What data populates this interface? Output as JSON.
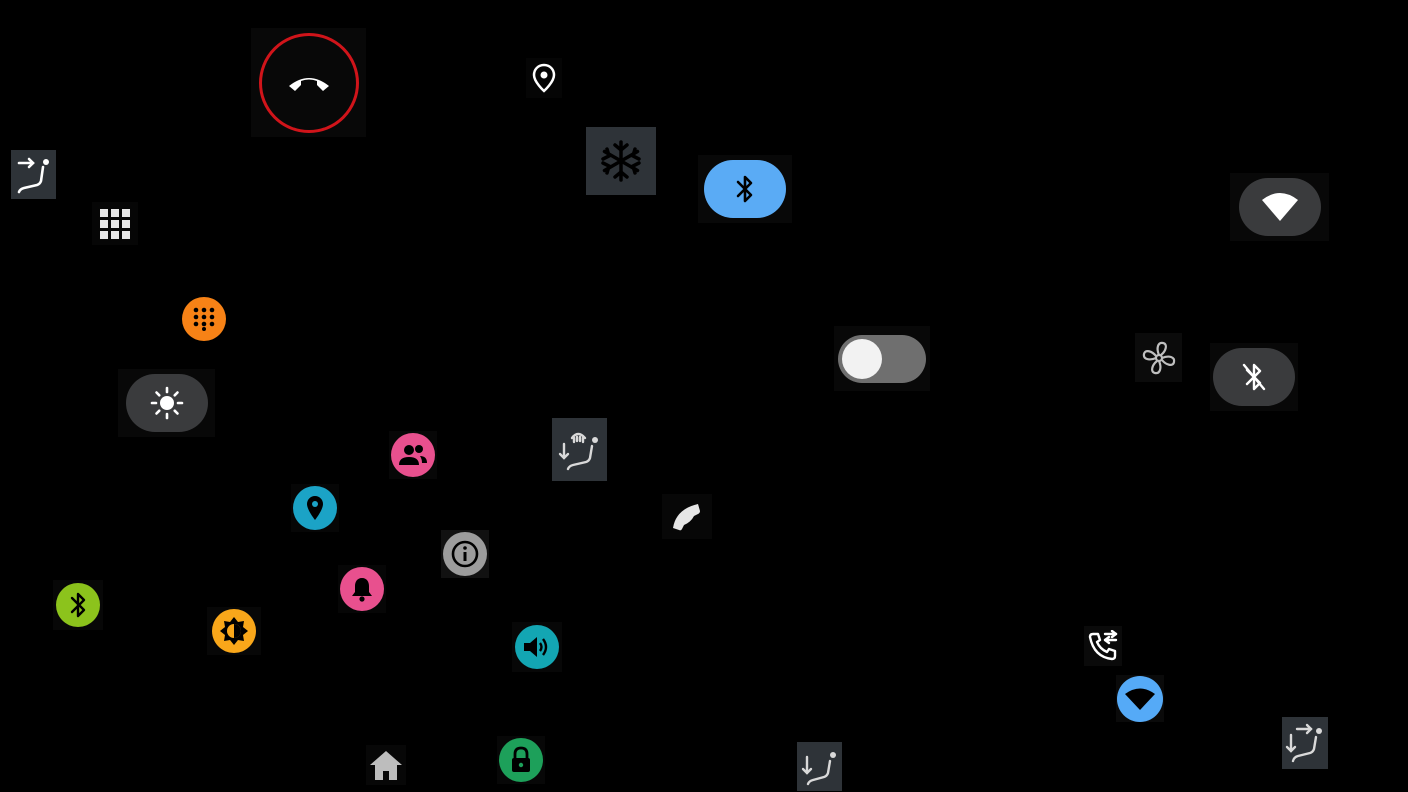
{
  "screen": "automotive-quick-controls-icon-sheet",
  "colors": {
    "background": "#000000",
    "hangup_ring": "#d0141a",
    "bluetooth_active": "#5aabf5",
    "pill_dark": "#3a3b3d",
    "toggle_track": "#6f6f6f",
    "seat_tile": "#2e3338",
    "orange": "#f78216",
    "green": "#8cc31c",
    "amber": "#f9a71a",
    "pink": "#e8508e",
    "teal": "#1ba3c6",
    "sound_teal": "#13a6b3",
    "lock_green": "#1da05a",
    "info_grey": "#9c9c9c",
    "wifi_blue": "#55aaf7"
  },
  "icons": [
    "hang-up-icon",
    "location-pin-icon",
    "snowflake-icon",
    "bluetooth-icon",
    "wifi-icon",
    "seat-direction-icon",
    "app-grid-icon",
    "dialpad-icon",
    "brightness-icon",
    "toggle-switch",
    "fan-icon",
    "bluetooth-off-icon",
    "seat-heat-icon",
    "contacts-icon",
    "map-pin-icon",
    "phone-icon",
    "info-icon",
    "bluetooth-status-icon",
    "adaptive-brightness-icon",
    "notification-bell-icon",
    "volume-icon",
    "call-forward-icon",
    "wifi-signal-icon",
    "home-icon",
    "lock-icon",
    "seat-recline-icon",
    "seat-adjust-icon"
  ],
  "toggle": {
    "state": "off"
  }
}
